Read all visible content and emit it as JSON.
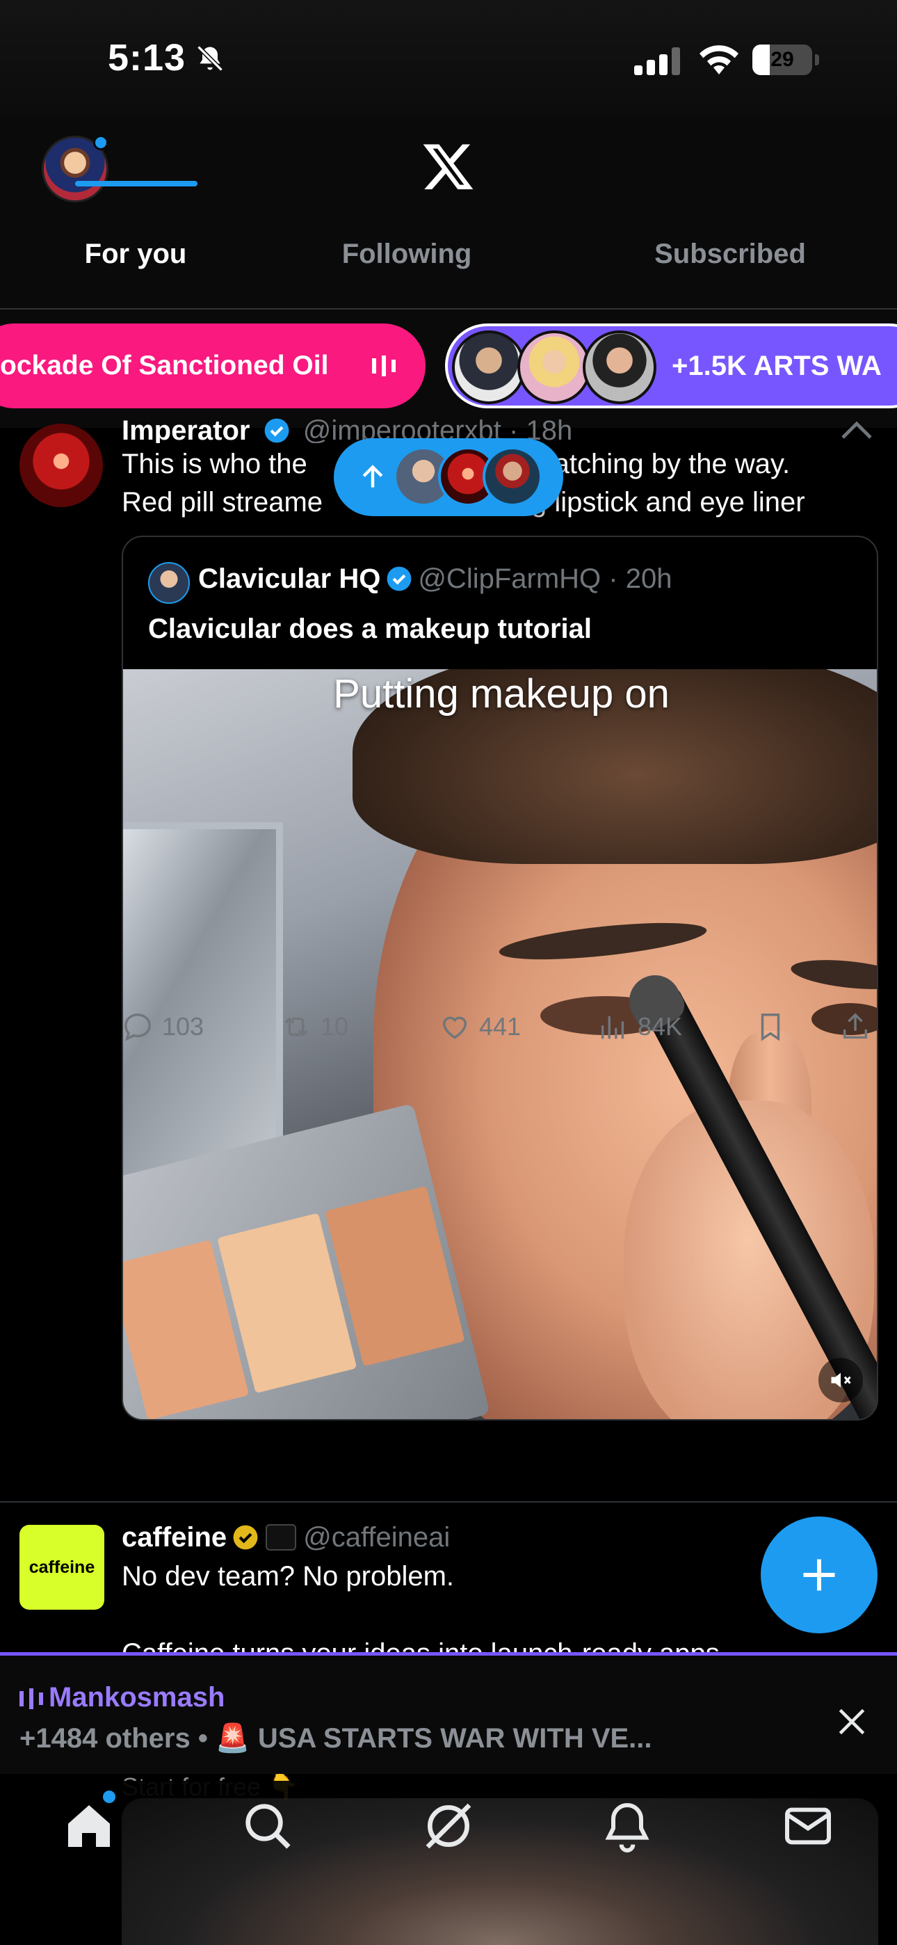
{
  "status_bar": {
    "time": "5:13",
    "battery": "29",
    "battery_level": 0.29
  },
  "header": {
    "tabs": [
      {
        "label": "For you",
        "active": true
      },
      {
        "label": "Following",
        "active": false
      },
      {
        "label": "Subscribed",
        "active": false
      }
    ]
  },
  "spaces": [
    {
      "title": "ockade Of Sanctioned Oil",
      "color": "#f9197f"
    },
    {
      "title": "+1.5K ARTS WA",
      "color": "#7856ff"
    }
  ],
  "new_posts_pill": {
    "icon": "arrow-up-icon"
  },
  "tweet1": {
    "name": "Imperator",
    "handle": "@imperooterxbt · 18h",
    "text_line1": "This is who the",
    "text_line1b": "watching by the way.",
    "text_line2": "Red pill streame",
    "text_line2b": "g lipstick and eye liner",
    "quote": {
      "name": "Clavicular HQ",
      "handle": "@ClipFarmHQ · 20h",
      "text": "Clavicular does a makeup tutorial",
      "video_caption": "Putting makeup on"
    },
    "actions": {
      "replies": "103",
      "reposts": "10",
      "likes": "441",
      "views": "84K"
    }
  },
  "tweet2": {
    "avatar_text": "caffeine",
    "name": "caffeine",
    "handle": "@caffeineai",
    "text": "No dev team? No problem.",
    "text2": "Caffeine turns your ideas into launch-ready apps"
  },
  "live_space": {
    "host": "Mankosmash",
    "subtitle": "+1484 others • 🚨 USA STARTS WAR WITH VE...",
    "peek": "Start for free 👇"
  },
  "colors": {
    "accent": "#1d9bf0",
    "spaces_pink": "#f9197f",
    "spaces_purple": "#7856ff"
  }
}
